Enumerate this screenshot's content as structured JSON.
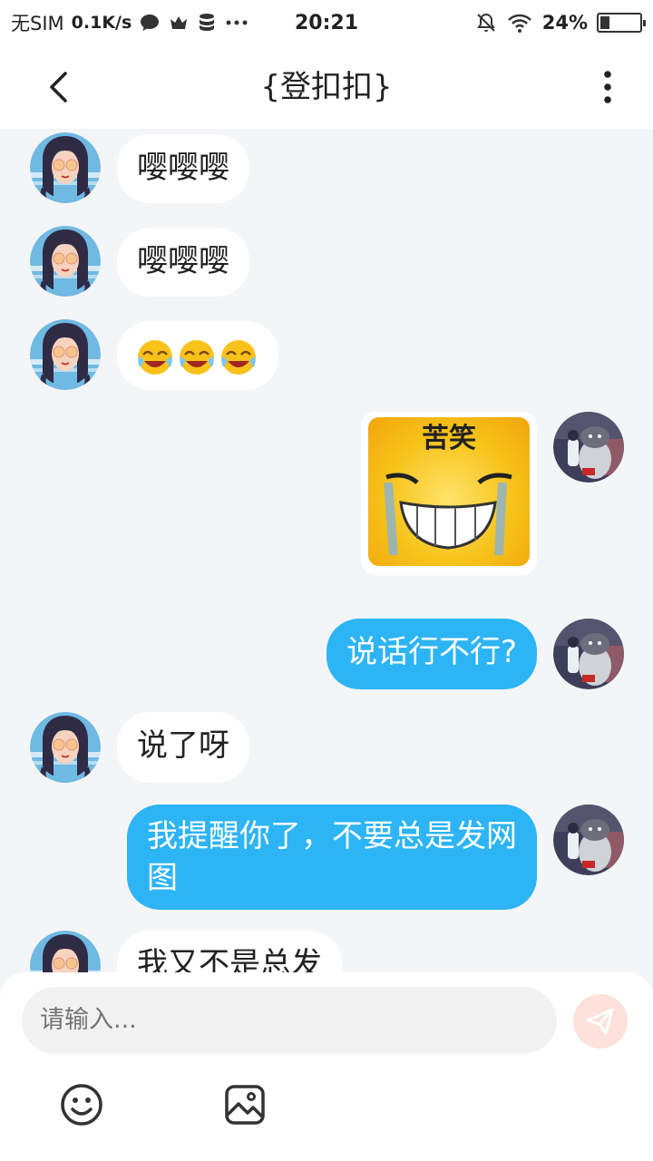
{
  "status_bar": {
    "carrier": "无SIM",
    "speed": "0.1K/s",
    "time": "20:21",
    "battery": "24%",
    "battery_level": 0.24
  },
  "header": {
    "title": "{登扣扣}"
  },
  "messages": [
    {
      "side": "in",
      "type": "text",
      "text": "嘤嘤嘤"
    },
    {
      "side": "in",
      "type": "text",
      "text": "嘤嘤嘤"
    },
    {
      "side": "in",
      "type": "emoji",
      "emoji": [
        "crying-laugh-emoji",
        "crying-laugh-emoji",
        "crying-laugh-emoji"
      ]
    },
    {
      "side": "out",
      "type": "sticker",
      "caption": "苦笑"
    },
    {
      "side": "out",
      "type": "text",
      "text": "说话行不行?"
    },
    {
      "side": "in",
      "type": "text",
      "text": "说了呀"
    },
    {
      "side": "out",
      "type": "text",
      "text": "我提醒你了，不要总是发网图"
    },
    {
      "side": "in",
      "type": "text",
      "text": "我又不是总发"
    }
  ],
  "input": {
    "placeholder": "请输入..."
  },
  "colors": {
    "accent": "#2db4f5",
    "background": "#f4f5f7",
    "send_disabled": "#fde1da"
  }
}
